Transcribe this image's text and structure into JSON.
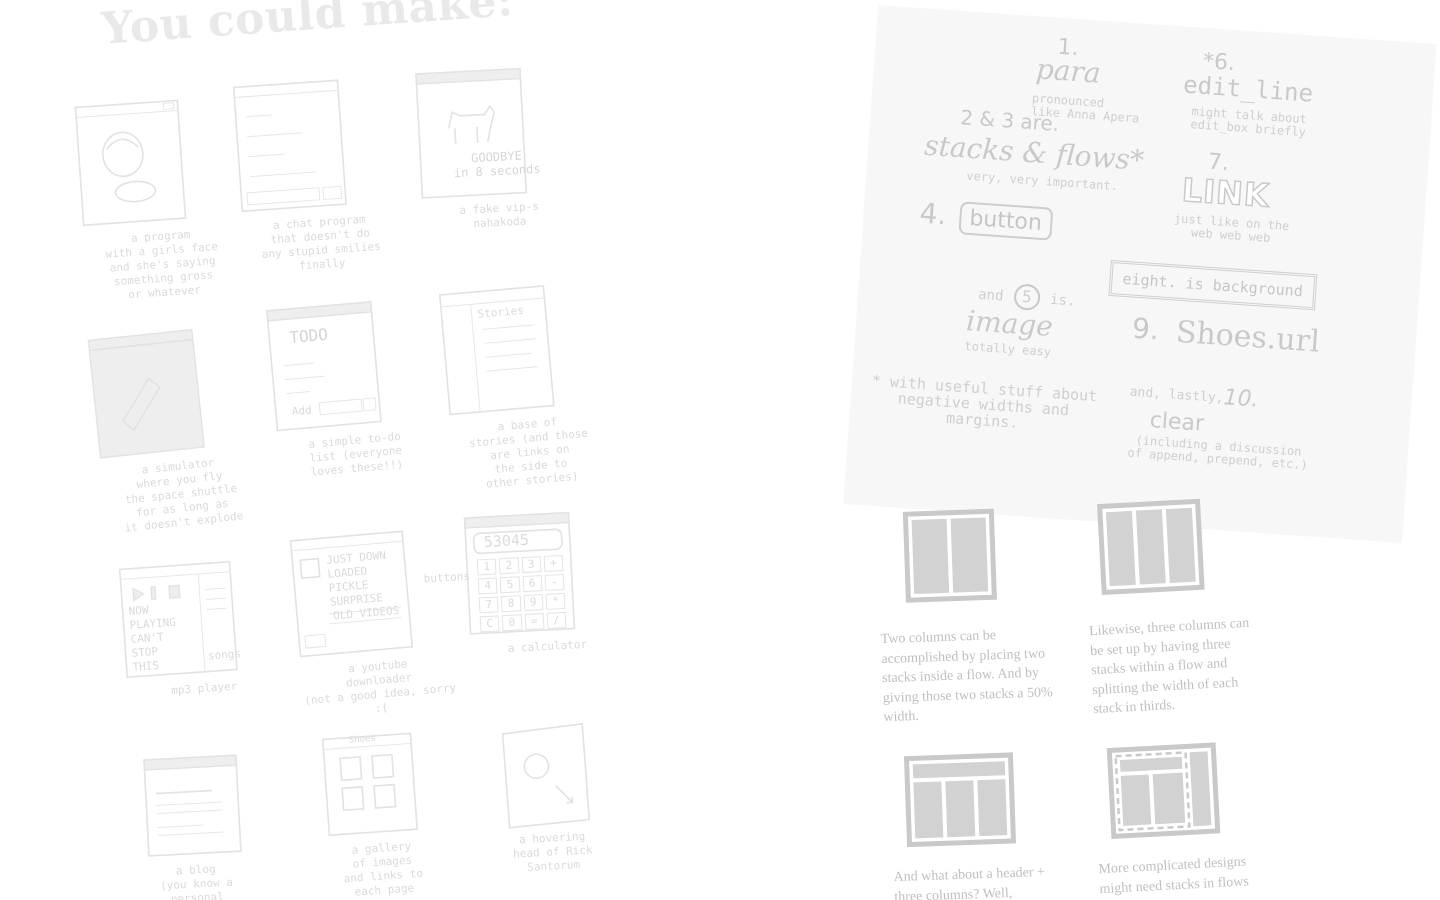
{
  "heading": "You could make:",
  "sketches": [
    {
      "caption": "a program\nwith a girls face\nand she's saying\nsomething gross\nor whatever"
    },
    {
      "caption": "a chat program\nthat doesn't do\nany stupid smilies\nfinally"
    },
    {
      "caption": "a fake vip-s\nnahakoda",
      "screen_text": "GOODBYE\nin 8 seconds"
    },
    {
      "caption": "a simulator\nwhere you fly\nthe space shuttle\nfor as long as\nit doesn't explode"
    },
    {
      "caption": "a simple to-do\nlist (everyone\nloves these!!)",
      "title": "TODO",
      "button": "Add"
    },
    {
      "caption": "a base of\nstories (and those\nare links on\nthe side to\nother stories)",
      "title": "Stories"
    },
    {
      "caption": "mp3 player",
      "screen_text": "NOW\nPLAYING\nCAN'T\nSTOP\nTHIS",
      "side_label": "songs"
    },
    {
      "caption": "a youtube\ndownloader\n(not a good idea, sorry :(",
      "screen_text": "JUST DOWN\nLOADED\nPICKLE\nSURPRISE",
      "list_text": "OLD VIDEOS"
    },
    {
      "caption": "a calculator",
      "display": "53045",
      "side_label": "buttons",
      "keys": [
        "1",
        "2",
        "3",
        "+",
        "4",
        "5",
        "6",
        "-",
        "7",
        "8",
        "9",
        "*",
        "C",
        "0",
        "=",
        "/"
      ]
    },
    {
      "caption": "a blog\n(you know a\npersonal journal)"
    },
    {
      "caption": "a gallery\nof images\nand links to\neach page",
      "title": "Shoes"
    },
    {
      "caption": "a hovering\nhead of Rick\nSantorum"
    }
  ],
  "outline": {
    "item1_num": "1.",
    "item1_title": "para",
    "item1_note": "pronounced\nlike Anna Apera",
    "item6_num": "*6.",
    "item6_title": "edit_line",
    "item6_note": "might talk about\nedit_box briefly",
    "item23_num": "2 & 3 are.",
    "item23_title": "stacks & flows*",
    "item23_note": "very, very important.",
    "item7_num": "7.",
    "item7_title": "LINK",
    "item7_note": "just like on the\nweb web web",
    "item4_num": "4.",
    "item4_title": "button",
    "item8_title": "eight. is background",
    "item5_prefix": "and",
    "item5_num": "5",
    "item5_suffix": "is.",
    "item5_title": "image",
    "item5_note": "totally easy",
    "item9_num": "9.",
    "item9_title": "Shoes.url",
    "footnote": "* with useful stuff about\nnegative widths and\nmargins.",
    "item10_prefix": "and, lastly,",
    "item10_num": "10.",
    "item10_title": "clear",
    "item10_note": "(including a discussion\nof append, prepend, etc.)"
  },
  "diagrams": [
    {
      "caption": "Two columns can be accomplished by placing two stacks inside a flow.  And by giving those two stacks a 50% width."
    },
    {
      "caption": "Likewise, three columns can be set up by having three stacks within a flow and splitting the width of each stack in thirds."
    },
    {
      "caption": "And what about a header + three columns? Well,"
    },
    {
      "caption": "More complicated designs might need stacks in flows"
    }
  ],
  "colors": {
    "sketch_ink": "#e2e2e2",
    "card_background": "#f7f7f7",
    "diagram_frame": "#c9c9c9",
    "diagram_fill": "#d2d2d2",
    "caption_text": "#bfbfbf"
  }
}
